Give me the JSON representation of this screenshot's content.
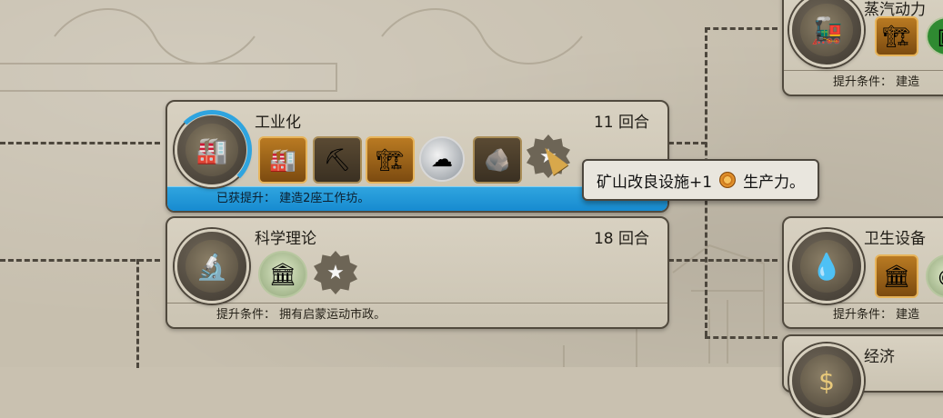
{
  "tooltip": {
    "prefix": "矿山改良设施+1",
    "icon": "production-icon",
    "suffix": "生产力。"
  },
  "cards": {
    "industrialization": {
      "title": "工业化",
      "turns": "11 回合",
      "footer": "已获提升：  建造2座工作坊。",
      "status": "boosted",
      "progress_fraction": 0.3,
      "icons": [
        "workshop-building-icon",
        "mine-improvement-icon",
        "factory-building-icon",
        "resource-icon",
        "quarry-improvement-icon",
        "star-policy-icon"
      ]
    },
    "scientific_theory": {
      "title": "科学理论",
      "turns": "18 回合",
      "footer": "提升条件：  拥有启蒙运动市政。",
      "icons": [
        "university-building-icon",
        "star-policy-icon"
      ]
    },
    "steam_power": {
      "title": "蒸汽动力",
      "footer": "提升条件：  建造"
    },
    "sanitation": {
      "title": "卫生设备",
      "footer": "提升条件：  建造"
    },
    "economics": {
      "title": "经济"
    }
  },
  "accent_colors": {
    "boost_blue": "#178bd0",
    "parchment": "#c7bfae",
    "frame": "#514a3e"
  }
}
